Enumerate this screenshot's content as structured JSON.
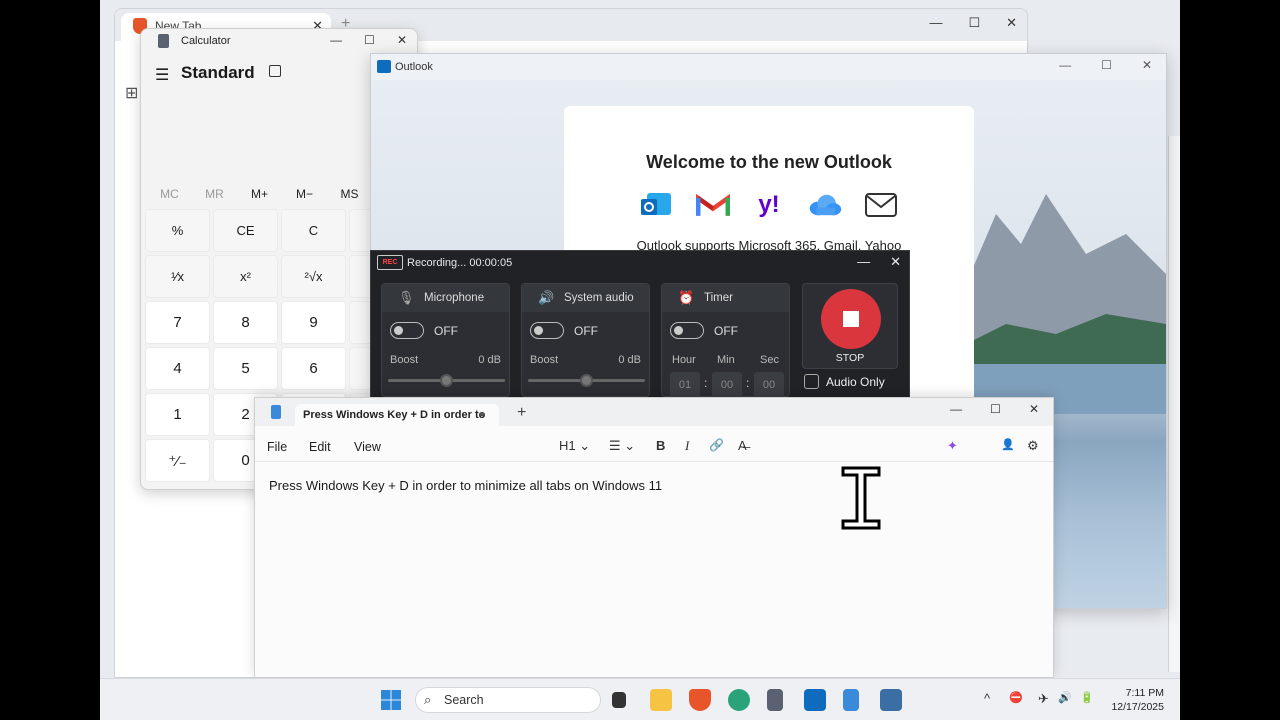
{
  "browser": {
    "tab_title": "New Tab",
    "close_glyph": "✕",
    "new_tab_glyph": "+",
    "min_glyph": "—",
    "max_glyph": "☐",
    "close_win_glyph": "✕",
    "apps_glyph": "⊞"
  },
  "calculator": {
    "title": "Calculator",
    "mode": "Standard",
    "min_glyph": "—",
    "max_glyph": "☐",
    "close_glyph": "✕",
    "memory": [
      "MC",
      "MR",
      "M+",
      "M−",
      "MS"
    ],
    "keys": [
      "%",
      "CE",
      "C",
      "",
      "¹⁄x",
      "x²",
      "²√x",
      "",
      "7",
      "8",
      "9",
      "",
      "4",
      "5",
      "6",
      "",
      "1",
      "2",
      "",
      "",
      "⁺⁄₋",
      "0",
      "",
      ""
    ]
  },
  "outlook": {
    "title": "Outlook",
    "welcome": "Welcome to the new Outlook",
    "subtext": "Outlook supports Microsoft 365, Gmail, Yahoo",
    "min_glyph": "—",
    "max_glyph": "☐",
    "close_glyph": "✕",
    "colors": {
      "outlook_blue": "#0f6cbd",
      "gmail_red": "#ea4335",
      "yahoo_purple": "#6001d2",
      "icloud_blue": "#3693f3"
    }
  },
  "recorder": {
    "title": "Recording... 00:00:05",
    "rec_badge": "REC",
    "min_glyph": "—",
    "close_glyph": "✕",
    "microphone": {
      "label": "Microphone",
      "state": "OFF",
      "boost_label": "Boost",
      "boost_value": "0 dB"
    },
    "system_audio": {
      "label": "System audio",
      "state": "OFF",
      "boost_label": "Boost",
      "boost_value": "0 dB"
    },
    "timer": {
      "label": "Timer",
      "state": "OFF",
      "hour_label": "Hour",
      "min_label": "Min",
      "sec_label": "Sec",
      "hour": "01",
      "min": "00",
      "sec": "00"
    },
    "stop_label": "STOP",
    "audio_only_label": "Audio Only"
  },
  "notepad": {
    "tab_title": "Press Windows Key + D in order to",
    "unsaved_dot": "●",
    "new_tab_glyph": "+",
    "min_glyph": "—",
    "max_glyph": "☐",
    "close_glyph": "✕",
    "menus": {
      "file": "File",
      "edit": "Edit",
      "view": "View"
    },
    "toolbar": {
      "heading": "H1",
      "list": "☰",
      "bold": "B",
      "italic": "I",
      "link": "🔗",
      "clear": "A̶",
      "copilot": "✦",
      "account": "👤",
      "settings": "⚙"
    },
    "body_text": "Press Windows Key + D in order to minimize all tabs on Windows 11"
  },
  "taskbar": {
    "search_placeholder": "Search",
    "time": "7:11 PM",
    "date": "12/17/2025",
    "tray": {
      "chevron": "^",
      "network": "⛔",
      "airplane": "✈",
      "volume": "🔊",
      "battery": "🔋"
    }
  }
}
